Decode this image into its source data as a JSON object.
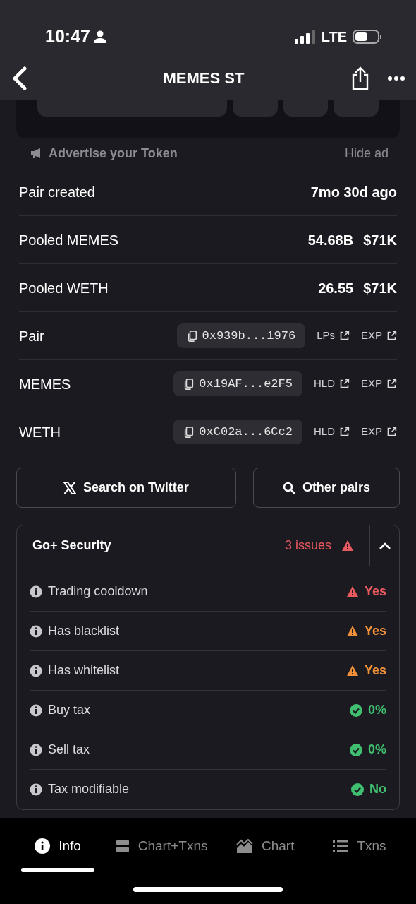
{
  "status_bar": {
    "time": "10:47",
    "network": "LTE"
  },
  "header": {
    "title": "MEMES ST"
  },
  "ad": {
    "label": "Advertise your Token",
    "hide": "Hide ad"
  },
  "stats": [
    {
      "label": "Pair created",
      "values": [
        "7mo 30d ago"
      ]
    },
    {
      "label": "Pooled MEMES",
      "values": [
        "54.68B",
        "$71K"
      ]
    },
    {
      "label": "Pooled WETH",
      "values": [
        "26.55",
        "$71K"
      ]
    }
  ],
  "addresses": [
    {
      "label": "Pair",
      "address": "0x939b...1976",
      "links": [
        "LPs",
        "EXP"
      ]
    },
    {
      "label": "MEMES",
      "address": "0x19AF...e2F5",
      "links": [
        "HLD",
        "EXP"
      ]
    },
    {
      "label": "WETH",
      "address": "0xC02a...6Cc2",
      "links": [
        "HLD",
        "EXP"
      ]
    }
  ],
  "actions": [
    {
      "kind": "twitter",
      "label": "Search on Twitter"
    },
    {
      "kind": "search",
      "label": "Other pairs"
    }
  ],
  "security": {
    "title": "Go+ Security",
    "issues": "3 issues",
    "expanded": true,
    "items": [
      {
        "label": "Trading cooldown",
        "value": "Yes",
        "kind": "danger"
      },
      {
        "label": "Has blacklist",
        "value": "Yes",
        "kind": "warning"
      },
      {
        "label": "Has whitelist",
        "value": "Yes",
        "kind": "warning"
      },
      {
        "label": "Buy tax",
        "value": "0%",
        "kind": "ok"
      },
      {
        "label": "Sell tax",
        "value": "0%",
        "kind": "ok"
      },
      {
        "label": "Tax modifiable",
        "value": "No",
        "kind": "ok"
      }
    ]
  },
  "tabs": [
    {
      "kind": "info",
      "label": "Info",
      "selected": true
    },
    {
      "kind": "split",
      "label": "Chart+Txns",
      "selected": false
    },
    {
      "kind": "chart",
      "label": "Chart",
      "selected": false
    },
    {
      "kind": "list",
      "label": "Txns",
      "selected": false
    }
  ]
}
